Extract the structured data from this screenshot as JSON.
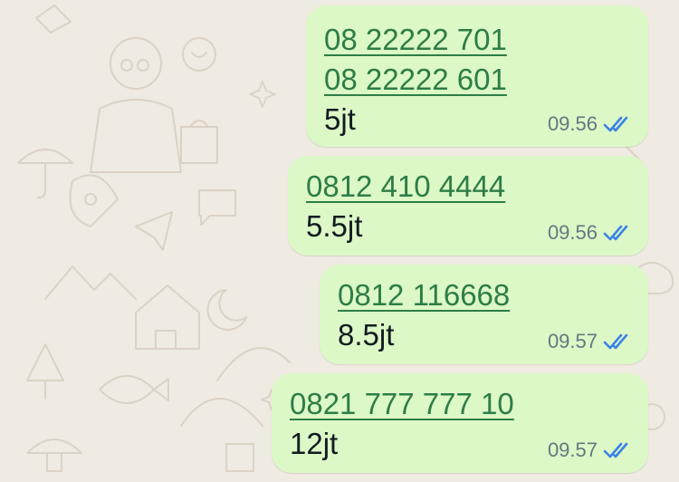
{
  "colors": {
    "bubble": "#dcf8c6",
    "link": "#2d7d46",
    "read_ticks": "#3b82e8",
    "time": "#667781",
    "wallpaper": "#efeae2"
  },
  "messages": [
    {
      "phones": [
        "08 22222 701",
        "08 22222 601"
      ],
      "text": "5jt",
      "time": "09.56",
      "status": "read-ticks-icon"
    },
    {
      "phones": [
        "0812 410 4444"
      ],
      "text": "5.5jt",
      "time": "09.56",
      "status": "read-ticks-icon"
    },
    {
      "phones": [
        "0812 116668"
      ],
      "text": "8.5jt",
      "time": "09.57",
      "status": "read-ticks-icon"
    },
    {
      "phones": [
        "0821 777 777 10"
      ],
      "text": "12jt",
      "time": "09.57",
      "status": "read-ticks-icon"
    }
  ]
}
